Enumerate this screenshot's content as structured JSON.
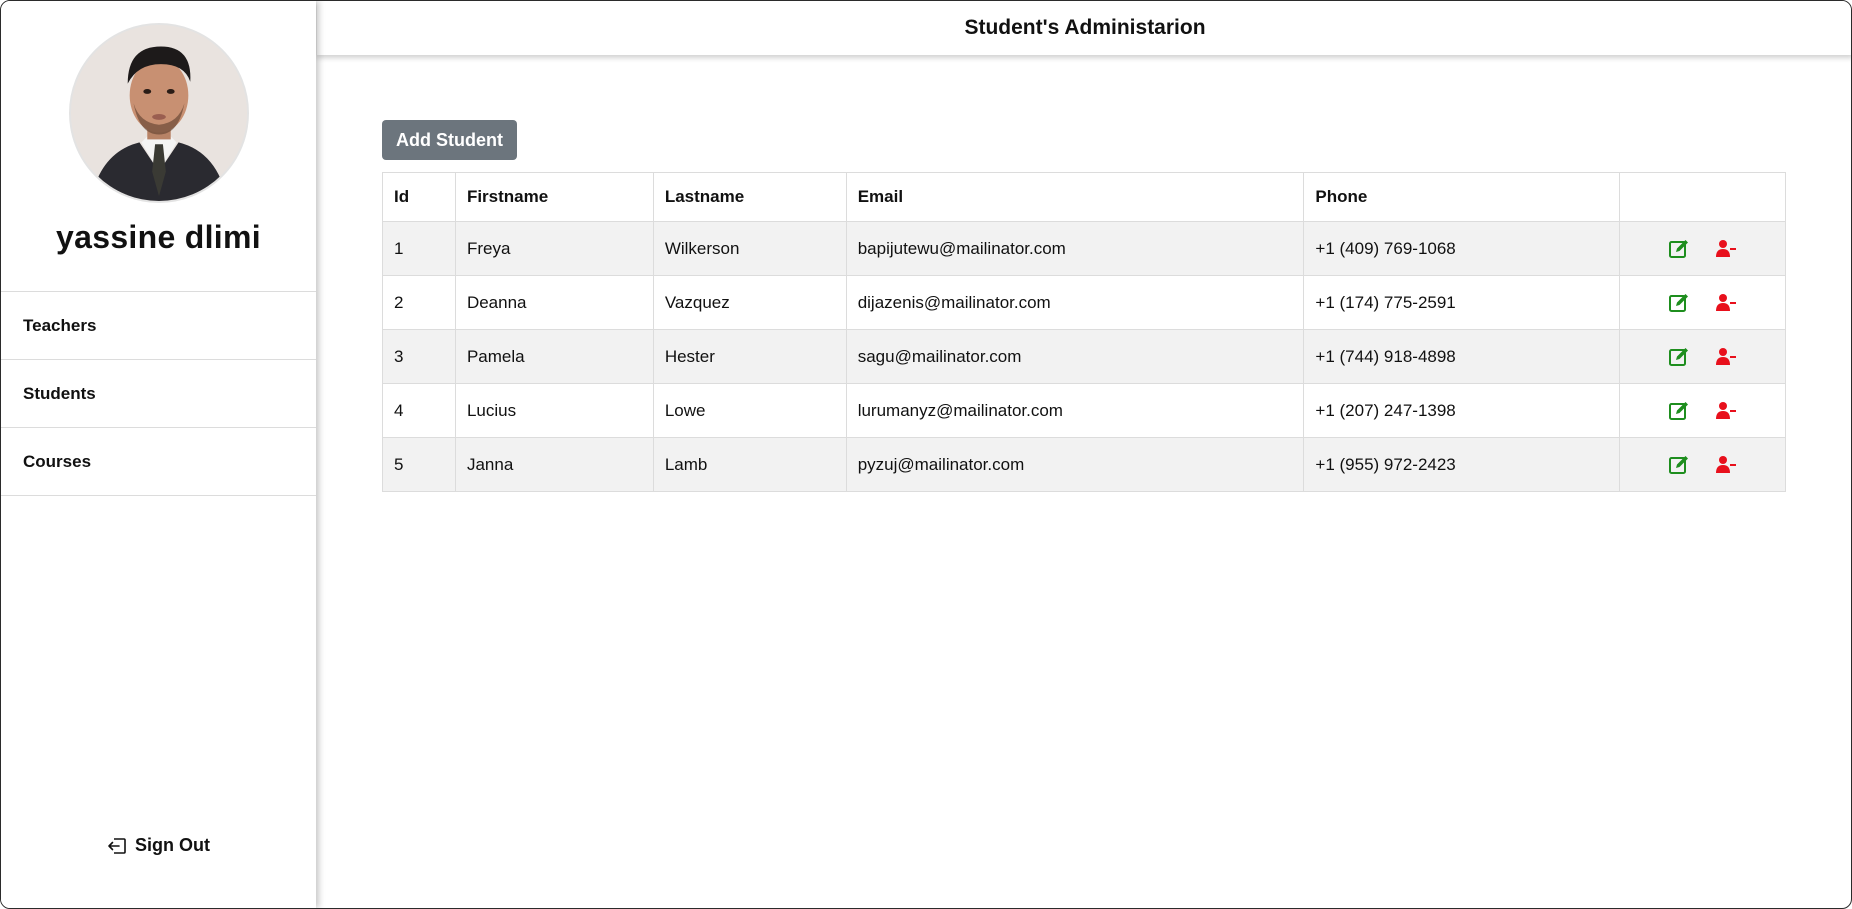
{
  "header": {
    "title": "Student's Administarion"
  },
  "profile": {
    "name": "yassine dlimi"
  },
  "sidebar": {
    "items": [
      {
        "label": "Teachers"
      },
      {
        "label": "Students"
      },
      {
        "label": "Courses"
      }
    ],
    "signout_label": "Sign Out"
  },
  "main": {
    "add_button_label": "Add Student",
    "table": {
      "columns": [
        "Id",
        "Firstname",
        "Lastname",
        "Email",
        "Phone",
        ""
      ],
      "rows": [
        {
          "id": "1",
          "firstname": "Freya",
          "lastname": "Wilkerson",
          "email": "bapijutewu@mailinator.com",
          "phone": "+1 (409) 769-1068"
        },
        {
          "id": "2",
          "firstname": "Deanna",
          "lastname": "Vazquez",
          "email": "dijazenis@mailinator.com",
          "phone": "+1 (174) 775-2591"
        },
        {
          "id": "3",
          "firstname": "Pamela",
          "lastname": "Hester",
          "email": "sagu@mailinator.com",
          "phone": "+1 (744) 918-4898"
        },
        {
          "id": "4",
          "firstname": "Lucius",
          "lastname": "Lowe",
          "email": "lurumanyz@mailinator.com",
          "phone": "+1 (207) 247-1398"
        },
        {
          "id": "5",
          "firstname": "Janna",
          "lastname": "Lamb",
          "email": "pyzuj@mailinator.com",
          "phone": "+1 (955) 972-2423"
        }
      ],
      "row_actions": {
        "edit_icon": "edit-icon",
        "remove_icon": "user-minus-icon"
      }
    }
  },
  "colors": {
    "button_bg": "#6c757d",
    "edit_icon": "#1e8e1e",
    "remove_icon": "#e8101c",
    "row_stripe": "#f2f2f2"
  }
}
